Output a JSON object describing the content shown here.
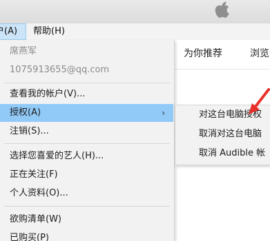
{
  "menubar": {
    "account_label": "户(A)",
    "help_label": "帮助(H)"
  },
  "account_menu": {
    "user_name": "席燕军",
    "user_email": "1075913655@qq.com",
    "view_account": "查看我的帐户(V)...",
    "authorize": "授权(A)",
    "sign_out": "注销(S)...",
    "choose_artists": "选择您喜爱的艺人(H)...",
    "following": "正在关注(F)",
    "profile": "个人资料(O)...",
    "wishlist": "欲购清单(W)",
    "purchased": "已购买(P)"
  },
  "authorize_submenu": {
    "authorize_computer": "对这台电脑授权",
    "deauthorize_computer": "取消对这台电脑",
    "deauthorize_audible": "取消 Audible 帐"
  },
  "store_tabs": {
    "for_you": "为你推荐",
    "browse": "浏览"
  },
  "colors": {
    "highlight": "#91c9f7",
    "menu_active": "#cce4f7",
    "annotation_arrow": "#e8302a"
  }
}
